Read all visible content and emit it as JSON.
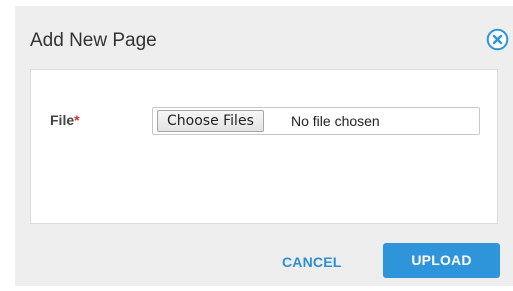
{
  "dialog": {
    "title": "Add New Page",
    "close_icon": "close-circle-icon",
    "colors": {
      "accent": "#2f95db",
      "required": "#d92b2b",
      "background": "#eeeeee"
    }
  },
  "form": {
    "file_label": "File",
    "required_mark": "*",
    "choose_files_label": "Choose Files",
    "file_status": "No file chosen"
  },
  "footer": {
    "cancel_label": "CANCEL",
    "upload_label": "UPLOAD"
  }
}
